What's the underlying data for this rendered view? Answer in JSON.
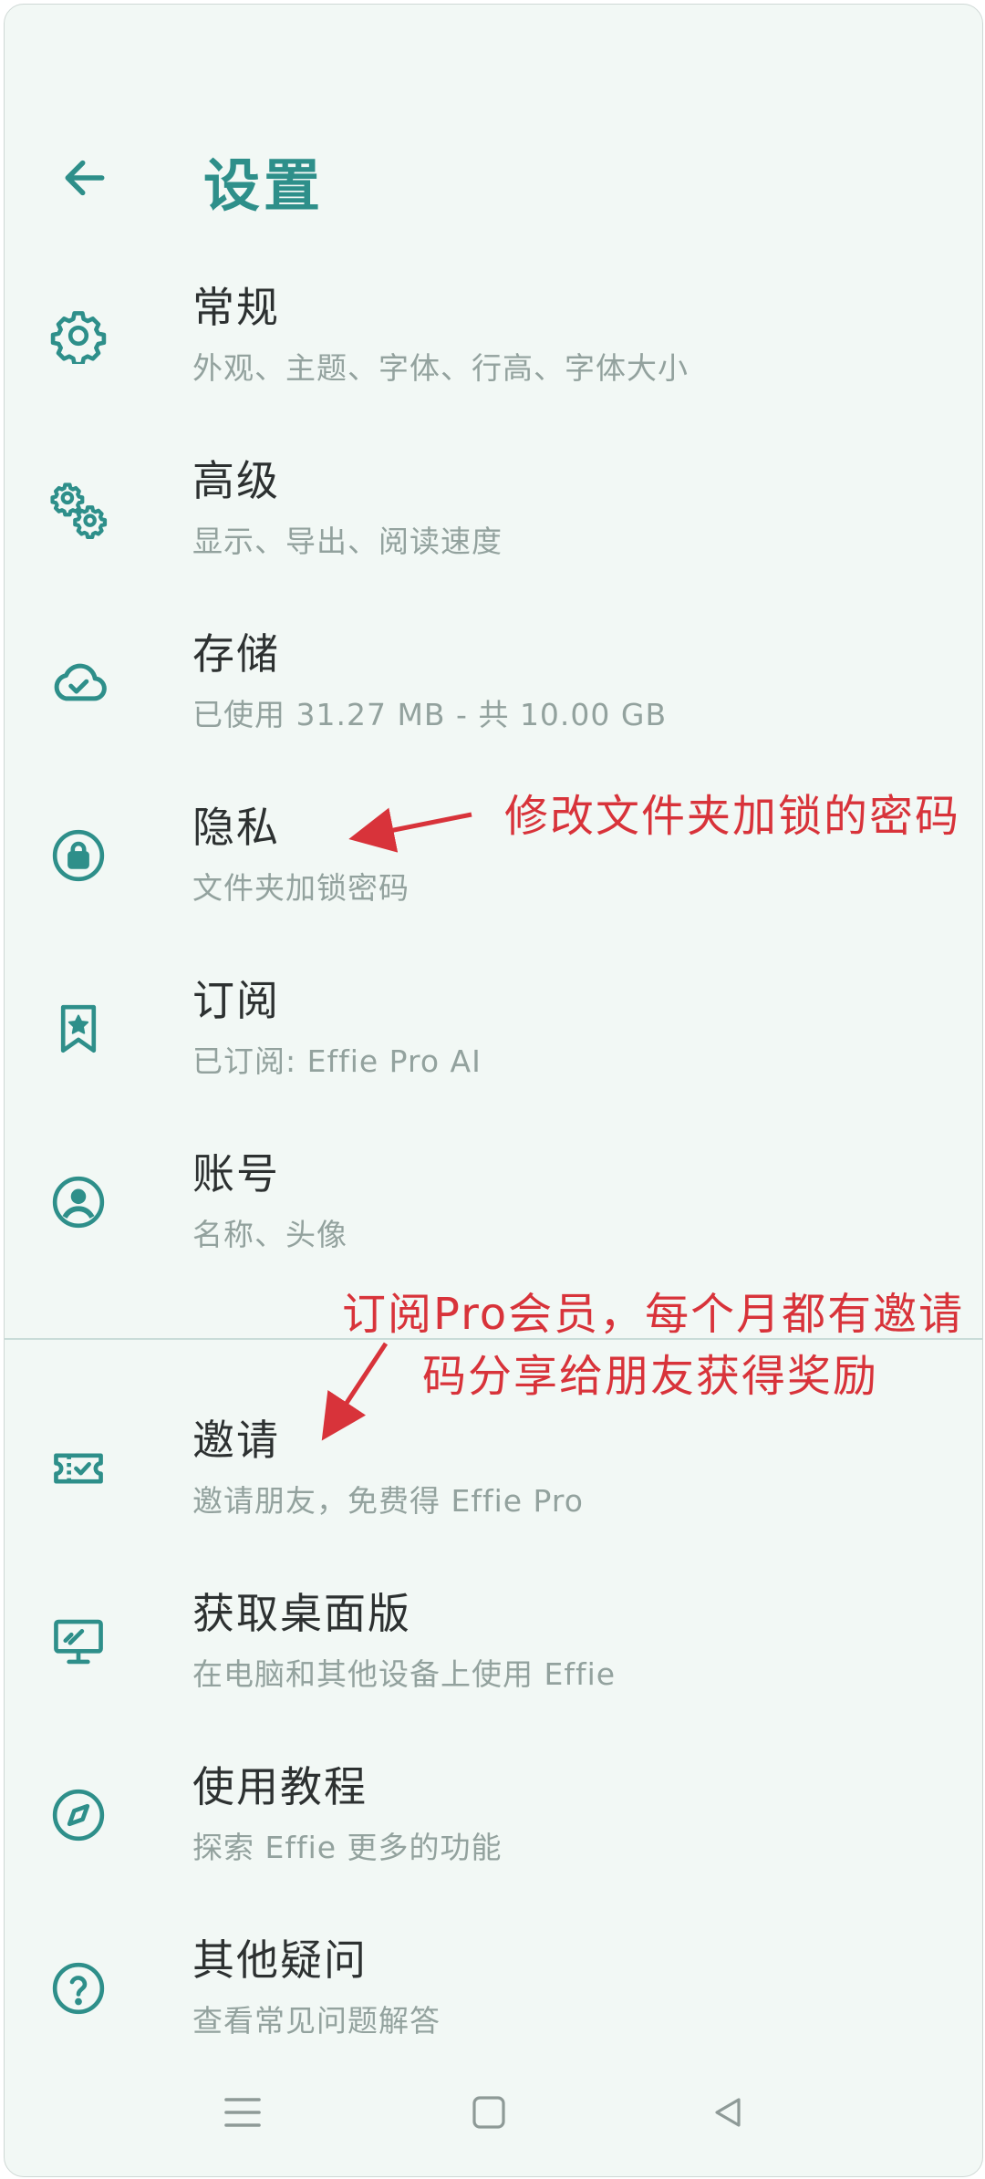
{
  "header": {
    "title": "设置",
    "back_icon": "arrow-left-icon"
  },
  "colors": {
    "accent": "#2e8f8a",
    "background": "#f2f8f5",
    "annotation": "#d8333a"
  },
  "settings": [
    {
      "label": "常规",
      "sub": "外观、主题、字体、行高、字体大小",
      "icon": "gear-icon"
    },
    {
      "label": "高级",
      "sub": "显示、导出、阅读速度",
      "icon": "gears-icon"
    },
    {
      "label": "存储",
      "sub": "已使用 31.27 MB - 共 10.00 GB",
      "icon": "cloud-check-icon"
    },
    {
      "label": "隐私",
      "sub": "文件夹加锁密码",
      "icon": "lock-icon"
    },
    {
      "label": "订阅",
      "sub": "已订阅: Effie Pro AI",
      "icon": "bookmark-star-icon"
    },
    {
      "label": "账号",
      "sub": "名称、头像",
      "icon": "account-icon"
    },
    {
      "label": "邀请",
      "sub": "邀请朋友，免费得 Effie Pro",
      "icon": "ticket-icon"
    },
    {
      "label": "获取桌面版",
      "sub": "在电脑和其他设备上使用 Effie",
      "icon": "desktop-icon"
    },
    {
      "label": "使用教程",
      "sub": "探索 Effie 更多的功能",
      "icon": "compass-icon"
    },
    {
      "label": "其他疑问",
      "sub": "查看常见问题解答",
      "icon": "help-icon"
    }
  ],
  "annotations": {
    "privacy_note": "修改文件夹加锁的密码",
    "invite_note_line1": "订阅Pro会员，每个月都有邀请",
    "invite_note_line2": "码分享给朋友获得奖励"
  },
  "nav": {
    "menu_icon": "menu-icon",
    "home_icon": "home-square-icon",
    "back_icon": "back-triangle-icon"
  }
}
